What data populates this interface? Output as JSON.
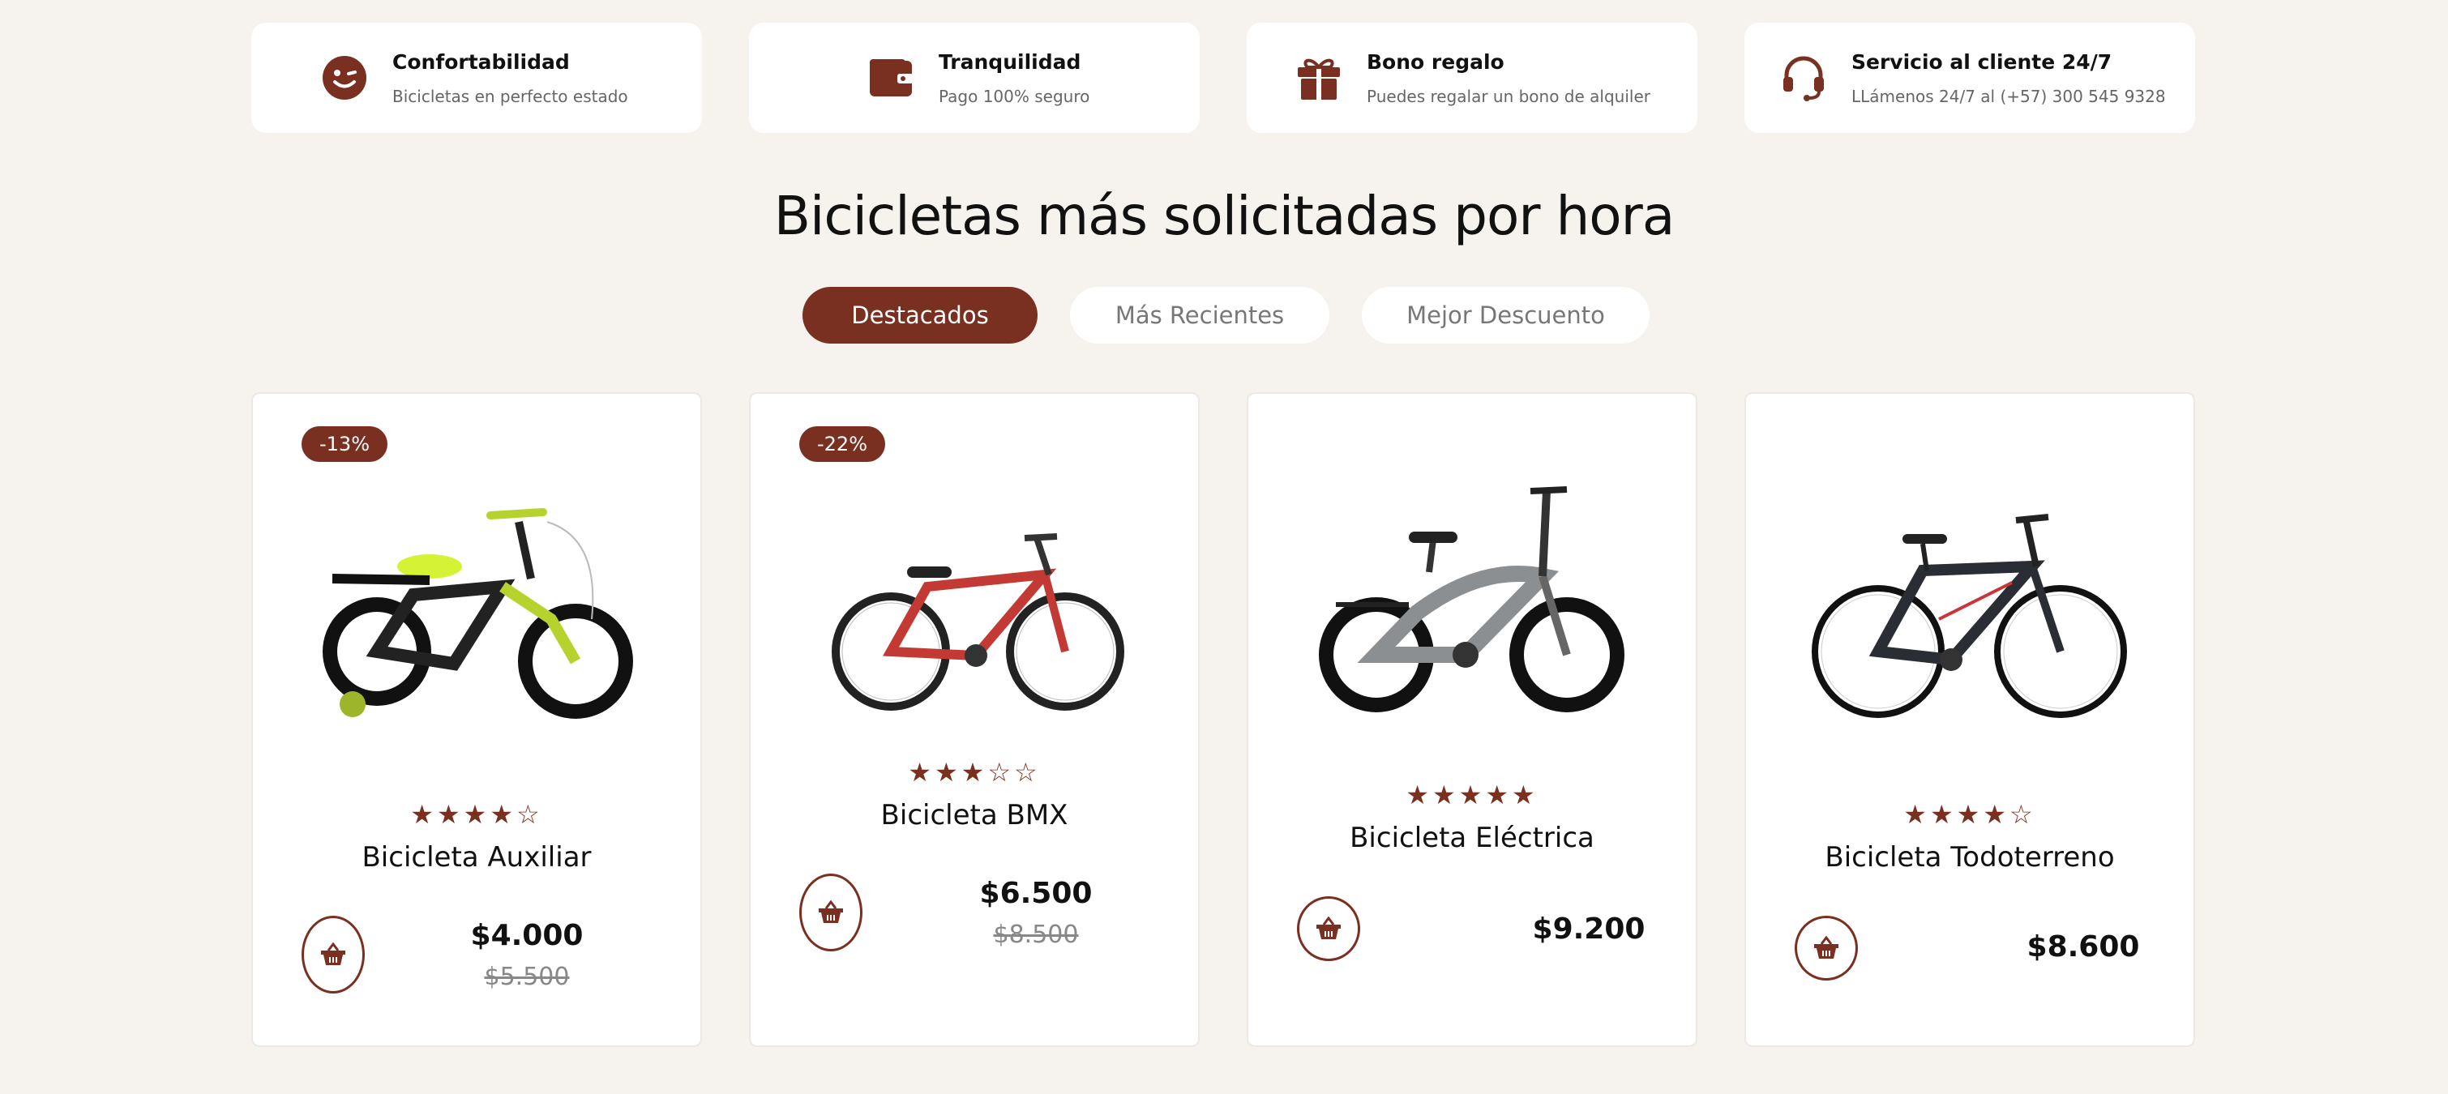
{
  "features": [
    {
      "title": "Confortabilidad",
      "subtitle": "Bicicletas en perfecto estado",
      "icon": "smiley-wink-icon"
    },
    {
      "title": "Tranquilidad",
      "subtitle": "Pago 100% seguro",
      "icon": "wallet-icon"
    },
    {
      "title": "Bono regalo",
      "subtitle": "Puedes regalar un bono de alquiler",
      "icon": "gift-icon"
    },
    {
      "title": "Servicio al cliente 24/7",
      "subtitle": "LLámenos 24/7 al (+57) 300 545 9328",
      "icon": "headset-icon"
    }
  ],
  "section_title": "Bicicletas más solicitadas por hora",
  "tabs": [
    {
      "label": "Destacados",
      "active": true
    },
    {
      "label": "Más Recientes",
      "active": false
    },
    {
      "label": "Mejor Descuento",
      "active": false
    }
  ],
  "products": [
    {
      "name": "Bicicleta Auxiliar",
      "price": "$4.000",
      "old_price": "$5.500",
      "discount": "-13%",
      "rating": 4,
      "stars": "★★★★☆"
    },
    {
      "name": "Bicicleta BMX",
      "price": "$6.500",
      "old_price": "$8.500",
      "discount": "-22%",
      "rating": 3,
      "stars": "★★★☆☆"
    },
    {
      "name": "Bicicleta Eléctrica",
      "price": "$9.200",
      "old_price": "",
      "discount": "",
      "rating": 5,
      "stars": "★★★★★"
    },
    {
      "name": "Bicicleta Todoterreno",
      "price": "$8.600",
      "old_price": "",
      "discount": "",
      "rating": 4,
      "stars": "★★★★☆"
    }
  ],
  "colors": {
    "accent": "#7a3020",
    "background": "#f6f3ef",
    "card": "#ffffff"
  }
}
